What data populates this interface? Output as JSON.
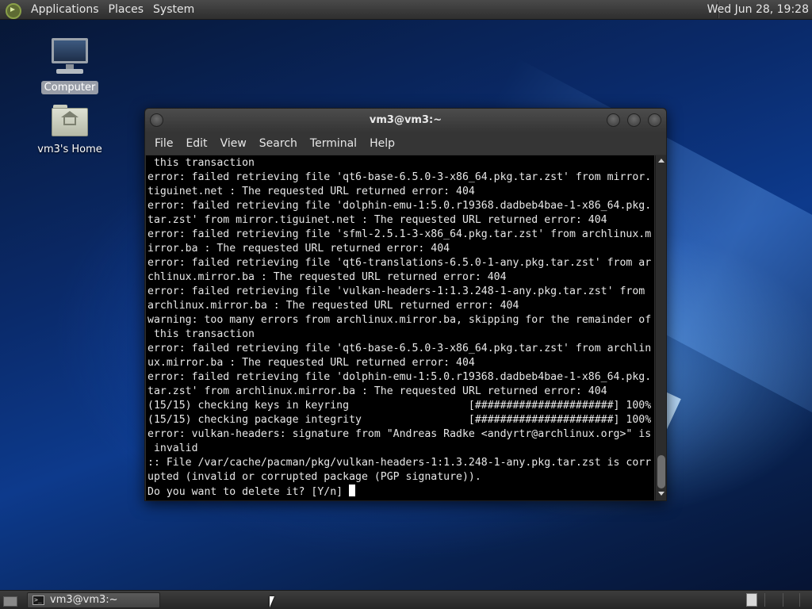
{
  "top_panel": {
    "menus": [
      "Applications",
      "Places",
      "System"
    ],
    "clock": "Wed Jun 28, 19:28"
  },
  "desktop_icons": [
    {
      "label": "Computer",
      "icon": "computer-icon",
      "selected": true
    },
    {
      "label": "vm3's Home",
      "icon": "home-folder-icon",
      "selected": false
    }
  ],
  "window": {
    "title": "vm3@vm3:~",
    "menus": [
      "File",
      "Edit",
      "View",
      "Search",
      "Terminal",
      "Help"
    ],
    "terminal_lines": [
      " this transaction",
      "error: failed retrieving file 'qt6-base-6.5.0-3-x86_64.pkg.tar.zst' from mirror.",
      "tiguinet.net : The requested URL returned error: 404",
      "error: failed retrieving file 'dolphin-emu-1:5.0.r19368.dadbeb4bae-1-x86_64.pkg.",
      "tar.zst' from mirror.tiguinet.net : The requested URL returned error: 404",
      "error: failed retrieving file 'sfml-2.5.1-3-x86_64.pkg.tar.zst' from archlinux.m",
      "irror.ba : The requested URL returned error: 404",
      "error: failed retrieving file 'qt6-translations-6.5.0-1-any.pkg.tar.zst' from ar",
      "chlinux.mirror.ba : The requested URL returned error: 404",
      "error: failed retrieving file 'vulkan-headers-1:1.3.248-1-any.pkg.tar.zst' from",
      "archlinux.mirror.ba : The requested URL returned error: 404",
      "warning: too many errors from archlinux.mirror.ba, skipping for the remainder of",
      " this transaction",
      "error: failed retrieving file 'qt6-base-6.5.0-3-x86_64.pkg.tar.zst' from archlin",
      "ux.mirror.ba : The requested URL returned error: 404",
      "error: failed retrieving file 'dolphin-emu-1:5.0.r19368.dadbeb4bae-1-x86_64.pkg.",
      "tar.zst' from archlinux.mirror.ba : The requested URL returned error: 404",
      "(15/15) checking keys in keyring                   [######################] 100%",
      "(15/15) checking package integrity                 [######################] 100%",
      "error: vulkan-headers: signature from \"Andreas Radke <andyrtr@archlinux.org>\" is",
      " invalid",
      ":: File /var/cache/pacman/pkg/vulkan-headers-1:1.3.248-1-any.pkg.tar.zst is corr",
      "upted (invalid or corrupted package (PGP signature)).",
      "Do you want to delete it? [Y/n] "
    ]
  },
  "taskbar": {
    "task_label": "vm3@vm3:~"
  }
}
